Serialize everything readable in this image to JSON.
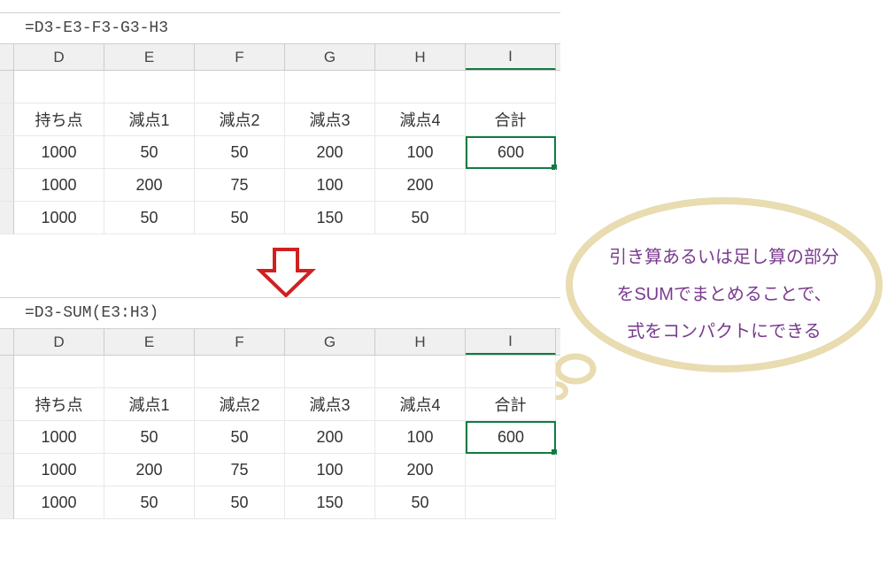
{
  "top": {
    "formula": "=D3-E3-F3-G3-H3",
    "cols": [
      "D",
      "E",
      "F",
      "G",
      "H",
      "I"
    ],
    "selected_col_index": 5,
    "rows": [
      {
        "cells": [
          "",
          "",
          "",
          "",
          "",
          ""
        ]
      },
      {
        "cells": [
          "持ち点",
          "減点1",
          "減点2",
          "減点3",
          "減点4",
          "合計"
        ]
      },
      {
        "cells": [
          "1000",
          "50",
          "50",
          "200",
          "100",
          "600"
        ],
        "selected_index": 5
      },
      {
        "cells": [
          "1000",
          "200",
          "75",
          "100",
          "200",
          ""
        ]
      },
      {
        "cells": [
          "1000",
          "50",
          "50",
          "150",
          "50",
          ""
        ]
      }
    ]
  },
  "bottom": {
    "formula": "=D3-SUM(E3:H3)",
    "cols": [
      "D",
      "E",
      "F",
      "G",
      "H",
      "I"
    ],
    "selected_col_index": 5,
    "rows": [
      {
        "cells": [
          "",
          "",
          "",
          "",
          "",
          ""
        ]
      },
      {
        "cells": [
          "持ち点",
          "減点1",
          "減点2",
          "減点3",
          "減点4",
          "合計"
        ]
      },
      {
        "cells": [
          "1000",
          "50",
          "50",
          "200",
          "100",
          "600"
        ],
        "selected_index": 5
      },
      {
        "cells": [
          "1000",
          "200",
          "75",
          "100",
          "200",
          ""
        ]
      },
      {
        "cells": [
          "1000",
          "50",
          "50",
          "150",
          "50",
          ""
        ]
      }
    ]
  },
  "callout": {
    "line1": "引き算あるいは足し算の部分",
    "line2": "をSUMでまとめることで、",
    "line3": "式をコンパクトにできる"
  }
}
